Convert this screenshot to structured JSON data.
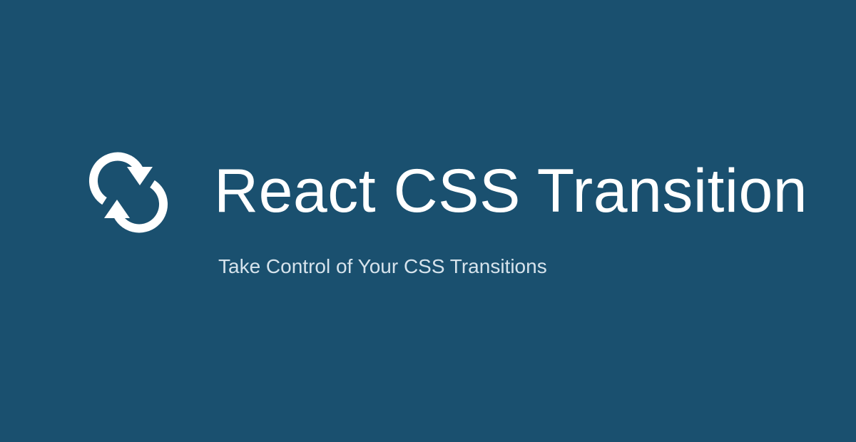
{
  "banner": {
    "title": "React CSS Transition",
    "subtitle": "Take Control of Your CSS Transitions",
    "logo_icon": "cycle-arrows-icon"
  },
  "colors": {
    "background": "#1a506f",
    "title": "#ffffff",
    "subtitle": "#d6e3ec",
    "logo": "#ffffff"
  }
}
